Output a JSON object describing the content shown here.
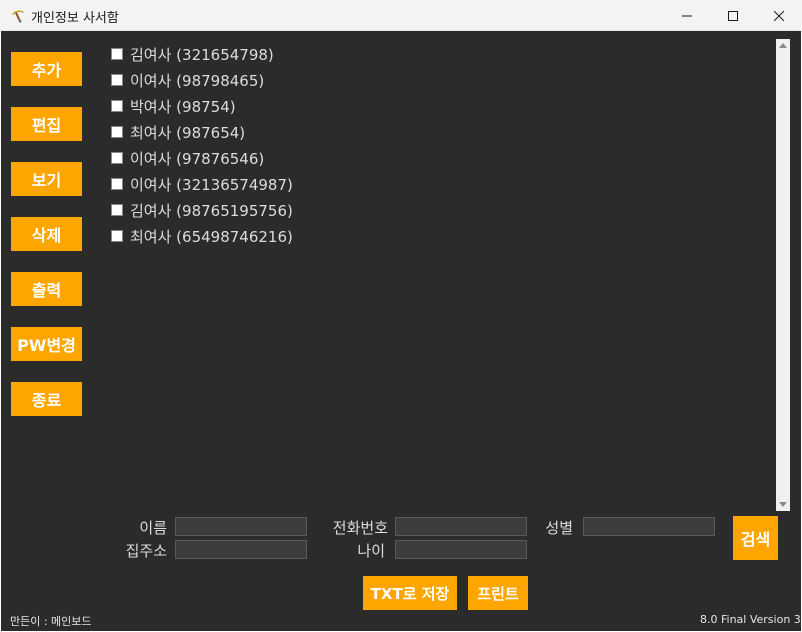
{
  "window": {
    "title": "개인정보 사서함"
  },
  "sidebar": {
    "buttons": [
      {
        "label": "추가"
      },
      {
        "label": "편집"
      },
      {
        "label": "보기"
      },
      {
        "label": "삭제"
      },
      {
        "label": "출력"
      },
      {
        "label": "PW변경"
      },
      {
        "label": "종료"
      }
    ]
  },
  "contacts": [
    {
      "text": "김여사 (321654798)",
      "checked": false
    },
    {
      "text": "이여사 (98798465)",
      "checked": false
    },
    {
      "text": "박여사 (98754)",
      "checked": false
    },
    {
      "text": "최여사 (987654)",
      "checked": false
    },
    {
      "text": "이여사 (97876546)",
      "checked": false
    },
    {
      "text": "이여사 (32136574987)",
      "checked": false
    },
    {
      "text": "김여사 (98765195756)",
      "checked": false
    },
    {
      "text": "최여사 (65498746216)",
      "checked": false
    }
  ],
  "search": {
    "name_label": "이름",
    "name_value": "",
    "phone_label": "전화번호",
    "phone_value": "",
    "gender_label": "성별",
    "gender_value": "",
    "address_label": "집주소",
    "address_value": "",
    "age_label": "나이",
    "age_value": "",
    "search_button": "검색"
  },
  "actions": {
    "save_txt": "TXT로 저장",
    "print": "프린트"
  },
  "footer": {
    "author": "만든이 : 메인보드",
    "version": "8.0 Final Version 3"
  },
  "colors": {
    "accent": "#ffa500",
    "background": "#2b2b2b",
    "text": "#dcdcdc"
  },
  "icons": {
    "app": "pickaxe-icon",
    "minimize": "minimize-icon",
    "maximize": "maximize-icon",
    "close": "close-icon"
  }
}
